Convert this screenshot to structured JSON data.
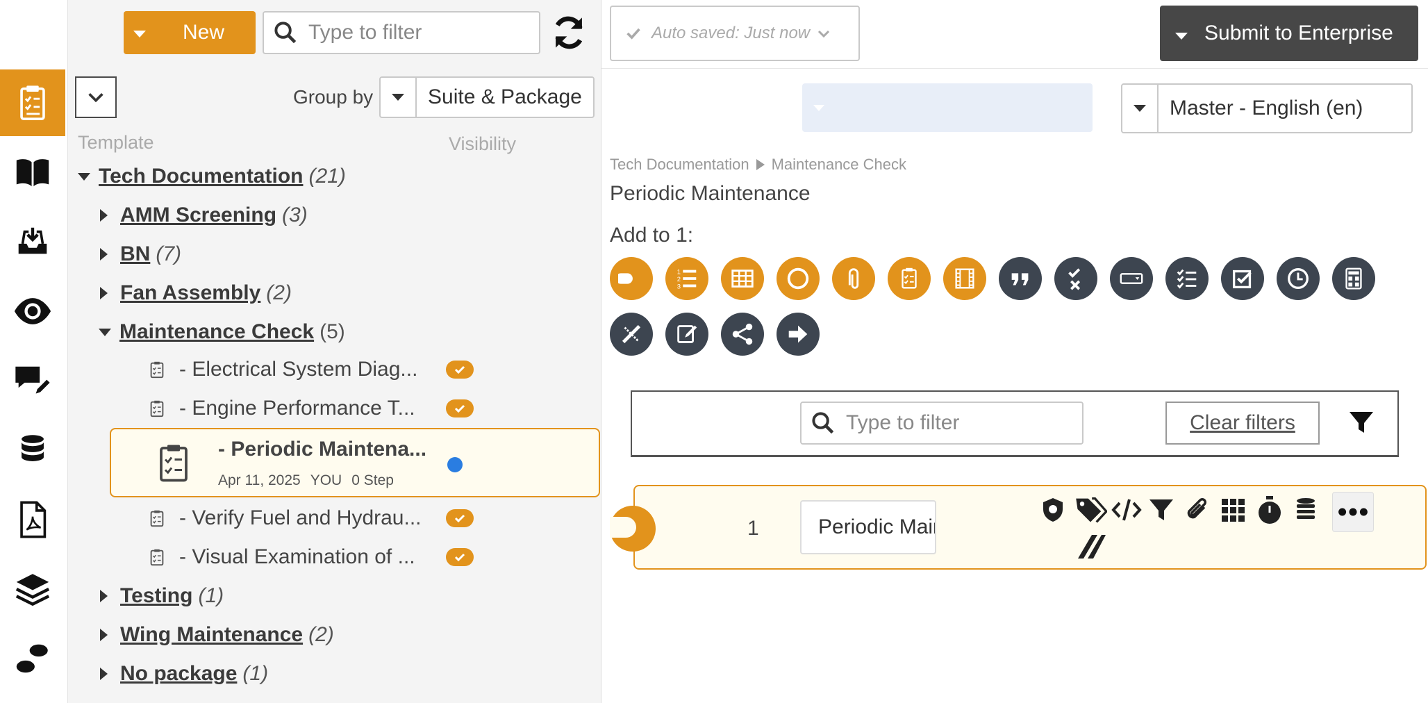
{
  "toolbar": {
    "new_label": "New",
    "filter_placeholder": "Type to filter"
  },
  "rail": {
    "items": [
      "checklist-icon",
      "book-icon",
      "inbox-download-icon",
      "eye-icon",
      "comments-edit-icon",
      "database-icon",
      "pdf-file-icon",
      "layers-icon",
      "footsteps-icon"
    ],
    "active": "checklist-icon"
  },
  "tree": {
    "group_by_label": "Group by",
    "group_by_value": "Suite & Package",
    "col_template": "Template",
    "col_visibility": "Visibility",
    "root": {
      "name": "Tech Documentation",
      "count": "(21)"
    },
    "packages_top": [
      {
        "name": "AMM Screening",
        "count": "(3)"
      },
      {
        "name": "BN",
        "count": "(7)"
      },
      {
        "name": "Fan Assembly",
        "count": "(2)"
      }
    ],
    "open_package": {
      "name": "Maintenance Check",
      "count": "(5)"
    },
    "templates": [
      {
        "label": "- Electrical System Diag..."
      },
      {
        "label": "- Engine Performance T..."
      },
      {
        "label": "- Verify Fuel and Hydrau..."
      },
      {
        "label": "- Visual Examination of ..."
      }
    ],
    "selected": {
      "title": "- Periodic Maintena...",
      "date": "Apr 11, 2025",
      "owner": "YOU",
      "steps": "0 Step"
    },
    "packages_bottom": [
      {
        "name": "Testing",
        "count": "(1)"
      },
      {
        "name": "Wing Maintenance",
        "count": "(2)"
      },
      {
        "name": "No package",
        "count": "(1)"
      }
    ]
  },
  "header": {
    "autosave": "Auto saved: Just now",
    "submit": "Submit to Enterprise",
    "language": "Master - English (en)"
  },
  "editor": {
    "breadcrumb": [
      "Tech Documentation",
      "Maintenance Check"
    ],
    "title": "Periodic Maintenance",
    "add_to": "Add to 1:",
    "step_types_orange": [
      "step-toggle-icon",
      "numbered-list-icon",
      "table-icon",
      "circle-icon",
      "attachment-icon",
      "checklist-icon",
      "film-icon"
    ],
    "step_types_dark": [
      "quote-icon",
      "check-x-icon",
      "dropdown-field-icon",
      "multi-check-icon",
      "checkbox-icon",
      "clock-icon",
      "calculator-icon",
      "pen-ruler-icon",
      "signature-icon",
      "share-icon",
      "arrow-right-icon"
    ],
    "filter_placeholder": "Type to filter",
    "clear_filters": "Clear filters",
    "step": {
      "number": "1",
      "value": "Periodic Maintenance"
    },
    "step_tools": [
      "shield-icon",
      "tags-icon",
      "code-icon",
      "filter-icon",
      "paperclip-icon",
      "grid-icon",
      "stopwatch-icon",
      "coins-icon",
      "more-icon",
      "skip-icon"
    ]
  },
  "colors": {
    "accent": "#e2931c",
    "dark_button": "#474747",
    "step_dark": "#3d4550",
    "status_blue": "#2a7de1"
  }
}
